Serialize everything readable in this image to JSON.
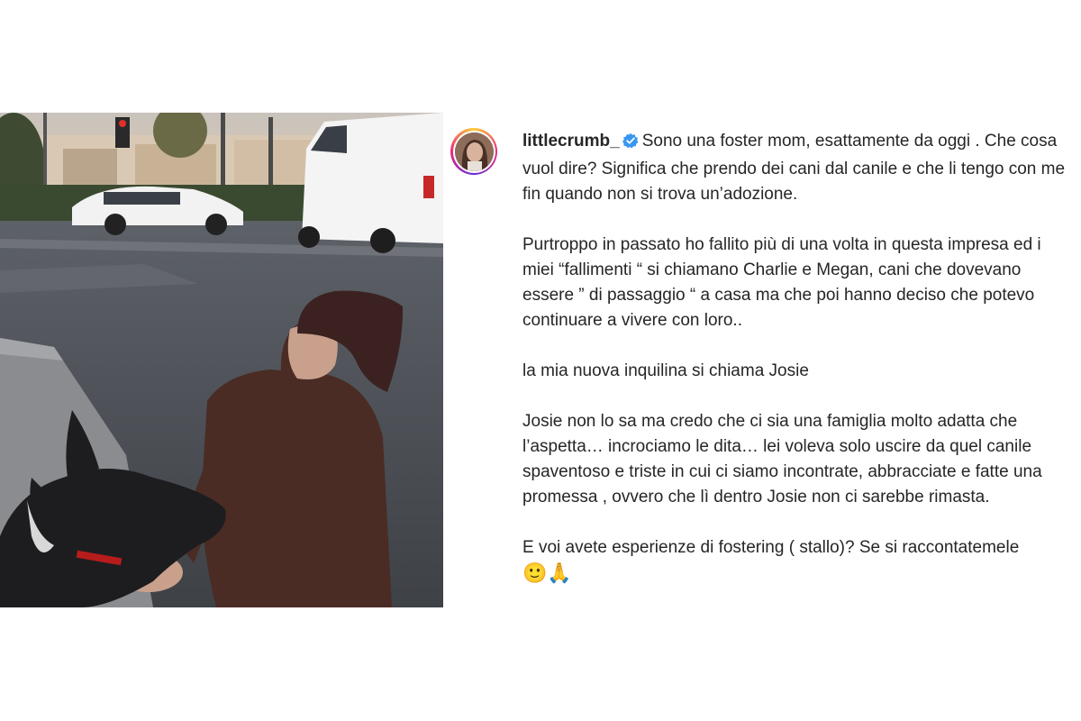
{
  "post": {
    "username": "littlecrumb_",
    "verified_icon": "verified-badge-icon",
    "paragraphs": [
      "Sono una foster mom, esattamente da oggi . Che cosa vuol dire? Significa che prendo dei cani dal canile e che li tengo con me fin quando non si trova un’adozione.",
      "Purtroppo in passato ho fallito più di una volta in questa impresa ed i miei “fallimenti “ si chiamano Charlie e Megan, cani che dovevano essere ” di passaggio “ a casa ma che poi hanno deciso che potevo continuare a vivere con loro..",
      "la mia nuova inquilina si chiama Josie",
      "Josie non lo sa ma credo che ci sia una famiglia molto adatta che l’aspetta… incrociamo le dita… lei voleva solo uscire da quel canile spaventoso e triste in cui ci siamo incontrate, abbracciate e fatte una promessa , ovvero che lì dentro Josie non ci sarebbe rimasta.",
      "E voi avete esperienze di fostering ( stallo)? Se si raccontatemele"
    ],
    "emojis": "🙂🙏"
  },
  "colors": {
    "verified": "#3897f0",
    "text": "#262626"
  }
}
